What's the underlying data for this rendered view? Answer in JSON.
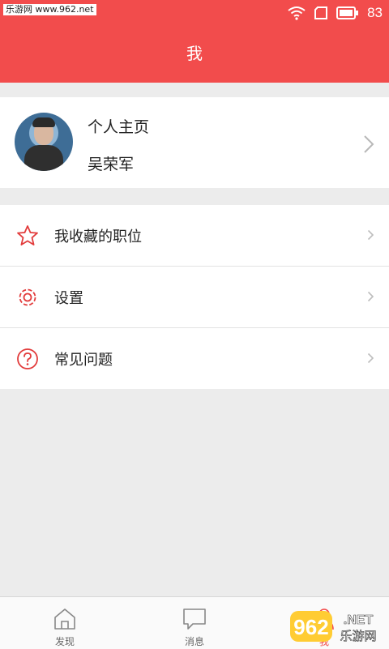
{
  "status_bar": {
    "watermark": "乐游网 www.962.net",
    "battery": "83"
  },
  "header": {
    "title": "我"
  },
  "profile": {
    "title": "个人主页",
    "name": "吴荣军"
  },
  "menu": {
    "items": [
      {
        "label": "我收藏的职位",
        "icon": "star-icon"
      },
      {
        "label": "设置",
        "icon": "gear-icon"
      },
      {
        "label": "常见问题",
        "icon": "question-icon"
      }
    ]
  },
  "tabbar": {
    "tabs": [
      {
        "label": "发现",
        "icon": "home-icon"
      },
      {
        "label": "消息",
        "icon": "message-icon"
      },
      {
        "label": "我",
        "icon": "person-icon",
        "active": true
      }
    ]
  },
  "logo": {
    "text1": "962",
    "text2": ".NET",
    "text3": "乐游网"
  },
  "colors": {
    "accent": "#f24c4c",
    "background": "#ececec"
  }
}
